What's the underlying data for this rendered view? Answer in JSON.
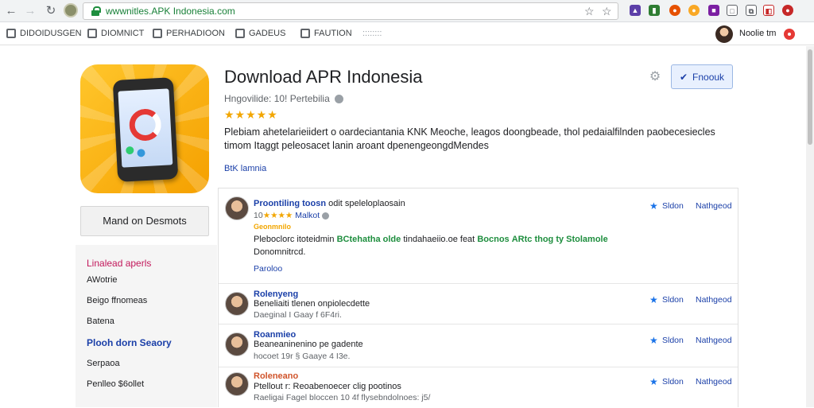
{
  "browser": {
    "url": "wwwnitles.APK Indonesia.com"
  },
  "bookmarks": {
    "items": [
      "DIDOIDUSGEN",
      "DIOMNICT",
      "PERHADIOON",
      "GADEUS",
      "FAUTION",
      "::::::::"
    ],
    "profile_name": "Noolie tm"
  },
  "app": {
    "title": "Download APR Indonesia",
    "subtitle": "Hngovilide: 10! Pertebilia",
    "rating_stars": "★★★★★",
    "description": "Plebiam ahetelarieiidert o oardeciantania KNK Meoche, leagos doongbeade, thol pedaialfilnden paobecesiecles timom Itaggt peleosacet lanin aroant dpenengeongdMendes",
    "more_link": "BtK lamnia",
    "share_label": "Fnoouk",
    "install_label": "Mand on Desmots"
  },
  "sidenav": {
    "items": [
      {
        "label": "Linalead aperls",
        "style": "red"
      },
      {
        "label": "AWotrie",
        "style": "plain"
      },
      {
        "label": "Beigo ffnomeas",
        "style": "plain"
      },
      {
        "label": "Batena",
        "style": "plain"
      },
      {
        "label": "Plooh dorn Seaory",
        "style": "blue"
      },
      {
        "label": "Serpaoa",
        "style": "plain"
      },
      {
        "label": "Penlleo $6ollet",
        "style": "plain"
      }
    ]
  },
  "reviews": [
    {
      "name": "Proontiling toosn",
      "name_extra": "odit speleloplaosain",
      "stars": "★★★★",
      "meta_prefix": "10",
      "meta": "Malkot",
      "tag": "Geonmnilo",
      "text_a": "Pleboclorc itoteidmin",
      "text_b": "BCtehatha",
      "text_c": "olde",
      "text_d": "tindahaeiio.oe feat",
      "text_e": "Bocnos",
      "text_f": "ARtc thog ty Stolamole",
      "text_line2": "Donomnitrcd.",
      "link": "Paroloo",
      "action1": "Sldon",
      "action2": "Nathgeod"
    },
    {
      "name": "Rolenyeng",
      "meta1": "Beneliaiti tlenen onpiolecdette",
      "meta2": "Daeginal I Gaay f 6F4ri.",
      "action1": "Sldon",
      "action2": "Nathgeod"
    },
    {
      "name": "Roanmieo",
      "meta1": "Beaneaninenino pe gadente",
      "meta2": "hocoet 19r § Gaaye 4 I3e.",
      "action1": "Sldon",
      "action2": "Nathgeod"
    },
    {
      "name": "Roleneano",
      "name_color": "#d0542b",
      "meta1": "Ptellout r: Reoabenoecer clig pootinos",
      "meta2": "Raeligai Fagel bloccen 10 4f flysebndolnoes: j5/",
      "action1": "Sldon",
      "action2": "Nathgeod"
    }
  ],
  "colors": {
    "accent_blue": "#1a3fa8",
    "star_orange": "#f2a600",
    "green": "#1e8e3e",
    "app_icon": "#ffc62b"
  }
}
